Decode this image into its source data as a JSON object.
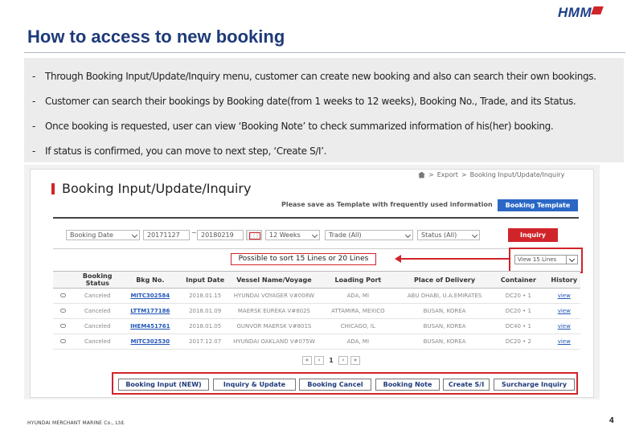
{
  "brand": {
    "logo_text": "HMM"
  },
  "slide": {
    "title": "How to access to new booking",
    "bullets": [
      {
        "dash": "-",
        "text": "Through Booking Input/Update/Inquiry menu, customer can create new booking and also can search their own bookings."
      },
      {
        "dash": "-",
        "text": "Customer can search their bookings by Booking date(from 1 weeks to 12 weeks), Booking No., Trade, and its Status."
      },
      {
        "dash": "-",
        "text": "Once booking is requested, user can view ‘Booking Note’ to check summarized information of his(her) booking."
      },
      {
        "dash": "-",
        "text": "If status is confirmed, you can move to next step, ‘Create S/I’."
      }
    ],
    "footer": "HYUNDAI MERCHANT MARINE Co., Ltd.",
    "page_number": "4"
  },
  "app": {
    "breadcrumb": [
      "Export",
      "Booking Input/Update/Inquiry"
    ],
    "breadcrumb_sep": ">",
    "page_title": "Booking Input/Update/Inquiry",
    "template_message": "Please save as Template with frequently used information",
    "template_button": "Booking Template",
    "filters": {
      "date_type": "Booking Date",
      "from_date": "20171127",
      "tilde": "~",
      "to_date": "20180219",
      "range": "12 Weeks",
      "trade": "Trade (All)",
      "status": "Status (All)",
      "inquiry_button": "Inquiry"
    },
    "annotation": "Possible to sort 15 Lines or 20 Lines",
    "view_select": "View 15 Lines",
    "table": {
      "headers": [
        "",
        "Booking Status",
        "Bkg No.",
        "Input Date",
        "Vessel Name/Voyage",
        "Loading Port",
        "Place of Delivery",
        "Container",
        "History"
      ],
      "rows": [
        {
          "status": "Canceled",
          "bkg": "MITC302584",
          "date": "2018.01.15",
          "vessel": "HYUNDAI VOYAGER V#008W",
          "pol": "ADA, MI",
          "del": "ABU DHABI, U.A.EMIRATES",
          "cntr": "DC20 • 1",
          "hist": "view"
        },
        {
          "status": "Canceled",
          "bkg": "LTTM177186",
          "date": "2018.01.09",
          "vessel": "MAERSK EUREKA V#802S",
          "pol": "ATTAMIRA, MEXICO",
          "del": "BUSAN, KOREA",
          "cntr": "DC20 • 1",
          "hist": "view"
        },
        {
          "status": "Canceled",
          "bkg": "IHEM451761",
          "date": "2018.01.05",
          "vessel": "GUNVOR MAERSK V#801S",
          "pol": "CHICAGO, IL",
          "del": "BUSAN, KOREA",
          "cntr": "DC40 • 1",
          "hist": "view"
        },
        {
          "status": "Canceled",
          "bkg": "MITC302530",
          "date": "2017.12.07",
          "vessel": "HYUNDAI OAKLAND V#075W",
          "pol": "ADA, MI",
          "del": "BUSAN, KOREA",
          "cntr": "DC20 • 2",
          "hist": "view"
        }
      ]
    },
    "pager": {
      "first": "«",
      "prev": "‹",
      "current": "1",
      "next": "›",
      "last": "»"
    },
    "actions": [
      "Booking Input (NEW)",
      "Inquiry & Update",
      "Booking Cancel",
      "Booking Note",
      "Create S/I",
      "Surcharge Inquiry"
    ]
  },
  "colors": {
    "brand_navy": "#1e3a78",
    "accent_red": "#d0232a",
    "button_blue": "#2b68c6",
    "link_blue": "#2457b8"
  }
}
